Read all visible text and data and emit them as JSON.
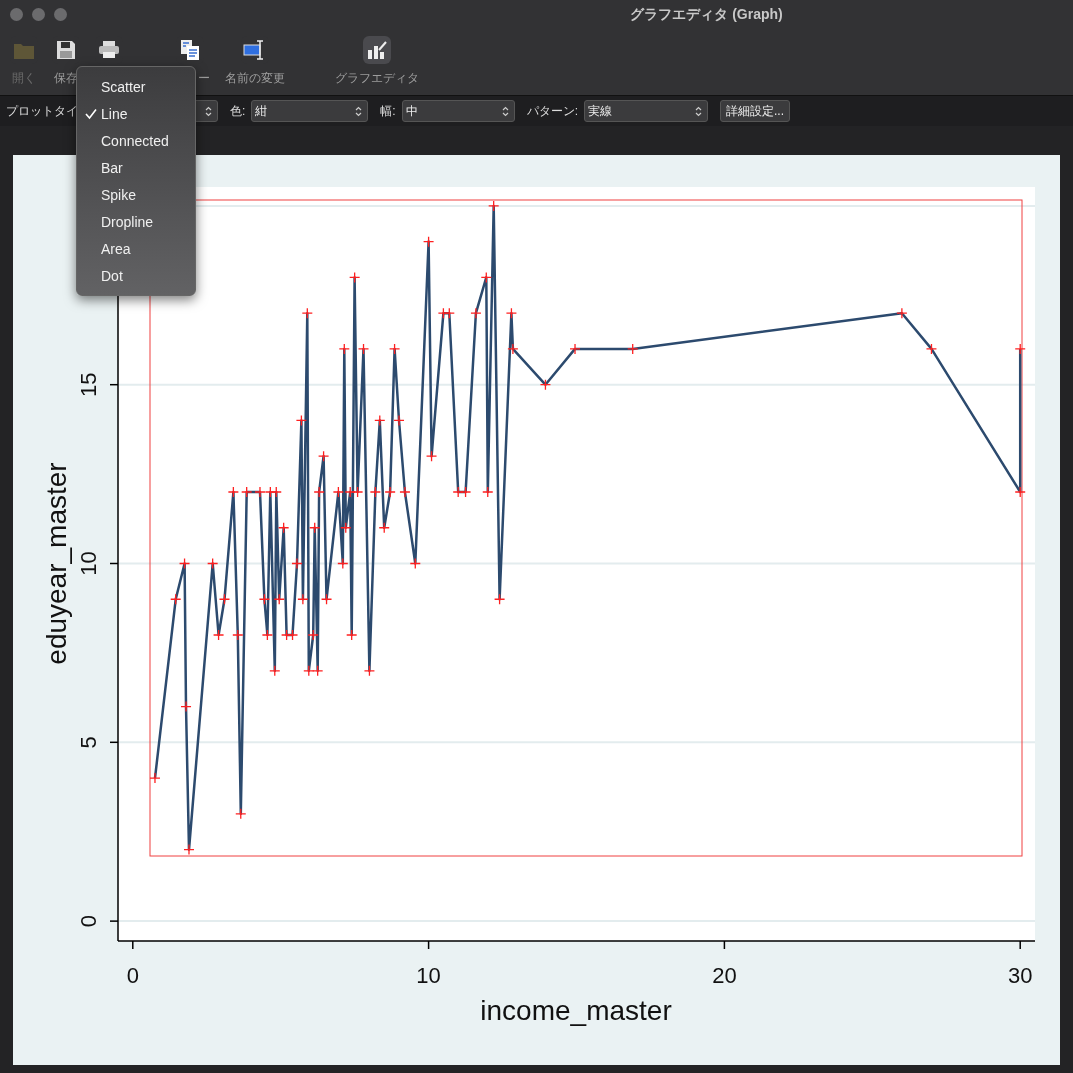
{
  "window": {
    "title": "グラフエディタ (Graph)"
  },
  "toolbar": [
    {
      "kind": "folder",
      "label": "開く",
      "disabled": true,
      "selected": false
    },
    {
      "kind": "save",
      "label": "保存",
      "disabled": false,
      "selected": false
    },
    {
      "kind": "print",
      "disabled": false,
      "selected": false
    },
    {
      "kind": "copy",
      "label": "ー",
      "disabled": false,
      "selected": false
    },
    {
      "kind": "rename",
      "label": "名前の変更",
      "disabled": false,
      "selected": false
    },
    {
      "kind": "grapheditor",
      "label": "グラフエディタ",
      "disabled": false,
      "selected": true
    }
  ],
  "property_bar": {
    "plot_type_label": "プロットタイ",
    "color_label": "色:",
    "color_value": "紺",
    "width_label": "幅:",
    "width_value": "中",
    "pattern_label": "パターン:",
    "pattern_value": "実線",
    "details_button": "詳細設定..."
  },
  "plot_type_menu": {
    "items": [
      {
        "label": "Scatter",
        "selected": false
      },
      {
        "label": "Line",
        "selected": true
      },
      {
        "label": "Connected",
        "selected": false
      },
      {
        "label": "Bar",
        "selected": false
      },
      {
        "label": "Spike",
        "selected": false
      },
      {
        "label": "Dropline",
        "selected": false
      },
      {
        "label": "Area",
        "selected": false
      },
      {
        "label": "Dot",
        "selected": false
      }
    ]
  },
  "graph": {
    "chart_data": {
      "type": "line",
      "grid": true,
      "xlabel": "income_master",
      "ylabel": "eduyear_master",
      "xlim": [
        -0.5,
        30.5
      ],
      "ylim": [
        -0.5,
        20.5
      ],
      "xticks": [
        0,
        10,
        20,
        30
      ],
      "yticks": [
        0,
        5,
        10,
        15
      ],
      "x": [
        0.75,
        1.45,
        1.75,
        1.8,
        1.9,
        2.7,
        2.9,
        3.1,
        3.4,
        3.55,
        3.65,
        3.85,
        4.3,
        4.45,
        4.55,
        4.65,
        4.8,
        4.85,
        4.95,
        5.1,
        5.2,
        5.4,
        5.55,
        5.7,
        5.75,
        5.9,
        5.95,
        6.1,
        6.15,
        6.25,
        6.3,
        6.45,
        6.55,
        6.95,
        7.1,
        7.15,
        7.2,
        7.35,
        7.4,
        7.5,
        7.6,
        7.8,
        8.0,
        8.2,
        8.35,
        8.5,
        8.7,
        8.85,
        9.0,
        9.2,
        9.55,
        10.0,
        10.1,
        10.5,
        10.7,
        11.0,
        11.25,
        11.6,
        11.95,
        12.0,
        12.2,
        12.4,
        12.8,
        12.85,
        13.95,
        14.95,
        16.9,
        26.0,
        27.0,
        30.0,
        30.0
      ],
      "series": [
        {
          "color": "#2c4a6e",
          "marker": "+",
          "values": [
            4,
            9,
            10,
            6,
            2,
            10,
            8,
            9,
            12,
            8,
            3,
            12,
            12,
            9,
            8,
            12,
            7,
            12,
            9,
            11,
            8,
            8,
            10,
            14,
            9,
            17,
            7,
            8,
            11,
            7,
            12,
            13,
            9,
            12,
            10,
            16,
            11,
            12,
            8,
            18,
            12,
            16,
            7,
            12,
            14,
            11,
            12,
            16,
            14,
            12,
            10,
            19,
            13,
            17,
            17,
            12,
            12,
            17,
            18,
            12,
            20,
            9,
            17,
            16,
            15,
            16,
            16,
            17,
            16,
            12,
            16
          ]
        }
      ]
    }
  }
}
